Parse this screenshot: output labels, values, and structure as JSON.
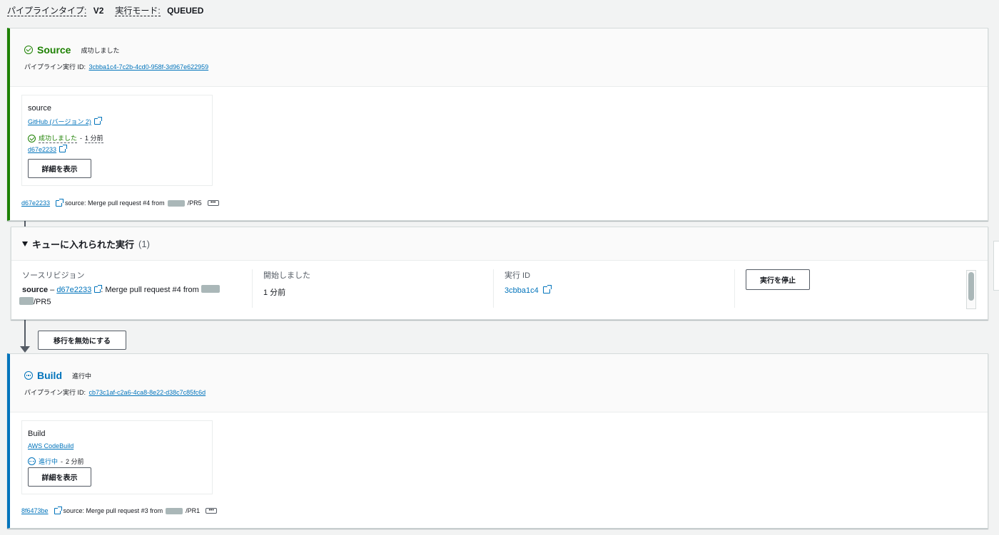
{
  "topbar": {
    "pipeline_type_label": "パイプラインタイプ:",
    "pipeline_type_value": "V2",
    "exec_mode_label": "実行モード:",
    "exec_mode_value": "QUEUED"
  },
  "source_stage": {
    "title": "Source",
    "status": "成功しました",
    "exec_id_label": "パイプライン実行 ID:",
    "exec_id": "3cbba1c4-7c2b-4cd0-958f-3d967e622959",
    "action": {
      "name": "source",
      "provider": "GitHub (バージョン 2)",
      "status": "成功しました",
      "sep": " - ",
      "time": "1 分前",
      "revision": "d67e2233",
      "details_button": "詳細を表示"
    },
    "footer": {
      "revision": "d67e2233",
      "message_prefix": "source: Merge pull request #4 from",
      "message_suffix": "/PR5",
      "more": "•••"
    }
  },
  "queue": {
    "title": "キューに入れられた実行",
    "count": "(1)",
    "columns": {
      "source_revision_header": "ソースリビジョン",
      "source_name": "source",
      "dash": " – ",
      "revision": "d67e2233",
      "message_prefix": ": Merge pull request #4 from",
      "message_suffix": "/PR5",
      "started_header": "開始しました",
      "started_value": "1 分前",
      "exec_id_header": "実行 ID",
      "exec_id_value": "3cbba1c4",
      "stop_button": "実行を停止"
    }
  },
  "transition": {
    "disable_button": "移行を無効にする"
  },
  "build_stage": {
    "title": "Build",
    "status": "進行中",
    "exec_id_label": "パイプライン実行 ID:",
    "exec_id": "cb73c1af-c2a6-4ca8-8e22-d38c7c85fc6d",
    "action": {
      "name": "Build",
      "provider": "AWS CodeBuild",
      "status": "進行中",
      "sep": " - ",
      "time": "2 分前",
      "details_button": "詳細を表示"
    },
    "footer": {
      "revision": "8f6473be",
      "message_prefix": "source: Merge pull request #3 from",
      "message_suffix": "/PR1",
      "more": "•••"
    }
  },
  "colors": {
    "success": "#1d8102",
    "in_progress": "#0073bb",
    "link": "#0073bb"
  }
}
